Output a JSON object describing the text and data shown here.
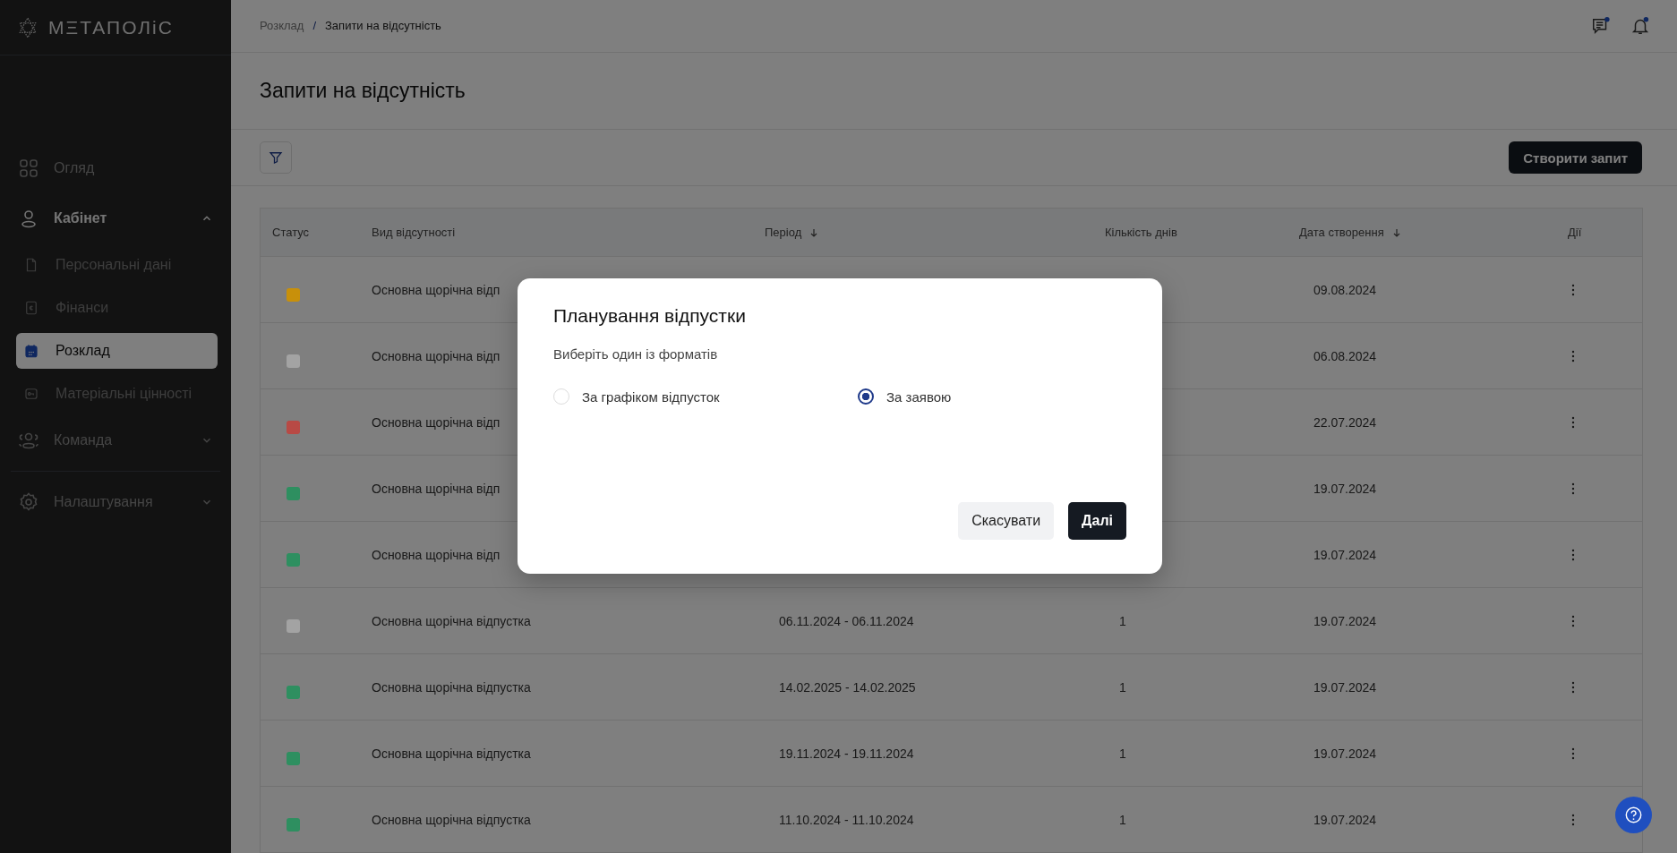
{
  "sidebar": {
    "logo": "МΞТАПОЛіС",
    "items": [
      {
        "label": "Огляд",
        "selected": false
      },
      {
        "label": "Кабінет",
        "expanded": true,
        "selected": false,
        "children": [
          {
            "label": "Персональні дані",
            "selected": false
          },
          {
            "label": "Фінанси",
            "selected": false
          },
          {
            "label": "Розклад",
            "selected": true
          },
          {
            "label": "Матеріальні цінності",
            "selected": false
          }
        ]
      },
      {
        "label": "Команда",
        "expanded": false,
        "selected": false
      },
      {
        "label": "Налаштування",
        "expanded": false,
        "selected": false
      }
    ]
  },
  "breadcrumb": {
    "items": [
      "Розклад",
      "Запити на відсутність"
    ],
    "separator": "/"
  },
  "header": {
    "chat_unread": true,
    "bell_unread": true
  },
  "page_title": "Запити на відсутність",
  "create_button": "Створити запит",
  "table": {
    "columns": [
      {
        "label": "Статус",
        "sorted": false
      },
      {
        "label": "Вид відсутності",
        "sorted": false
      },
      {
        "label": "Період",
        "sorted": true
      },
      {
        "label": "Кількість днів",
        "sorted": false
      },
      {
        "label": "Дата створення",
        "sorted": true
      },
      {
        "label": "Дії",
        "sorted": false
      }
    ],
    "rows": [
      {
        "color": "#c8900a",
        "type": "Основна щорічна відп",
        "created": "09.08.2024"
      },
      {
        "color": "#a3a3a3",
        "type": "Основна щорічна відп",
        "created": "06.08.2024"
      },
      {
        "color": "#b84a45",
        "type": "Основна щорічна відп",
        "created": "22.07.2024"
      },
      {
        "color": "#2e8f60",
        "type": "Основна щорічна відп",
        "created": "19.07.2024"
      },
      {
        "color": "#2e8f60",
        "type": "Основна щорічна відп",
        "created": "19.07.2024"
      },
      {
        "color": "#a3a3a3",
        "type": "Основна щорічна відпустка",
        "period": "06.11.2024 - 06.11.2024",
        "days": "1",
        "created": "19.07.2024"
      },
      {
        "color": "#2e8f60",
        "type": "Основна щорічна відпустка",
        "period": "14.02.2025 - 14.02.2025",
        "days": "1",
        "created": "19.07.2024"
      },
      {
        "color": "#2e8f60",
        "type": "Основна щорічна відпустка",
        "period": "19.11.2024 - 19.11.2024",
        "days": "1",
        "created": "19.07.2024"
      },
      {
        "color": "#2e8f60",
        "type": "Основна щорічна відпустка",
        "period": "11.10.2024 - 11.10.2024",
        "days": "1",
        "created": "19.07.2024"
      }
    ]
  },
  "modal": {
    "title": "Планування відпустки",
    "subtitle": "Виберіть один із форматів",
    "options": [
      {
        "label": "За графіком відпусток",
        "selected": false
      },
      {
        "label": "За заявою",
        "selected": true
      }
    ],
    "buttons": [
      {
        "label": "Скасувати",
        "kind": "secondary"
      },
      {
        "label": "Далі",
        "kind": "primary"
      }
    ]
  }
}
